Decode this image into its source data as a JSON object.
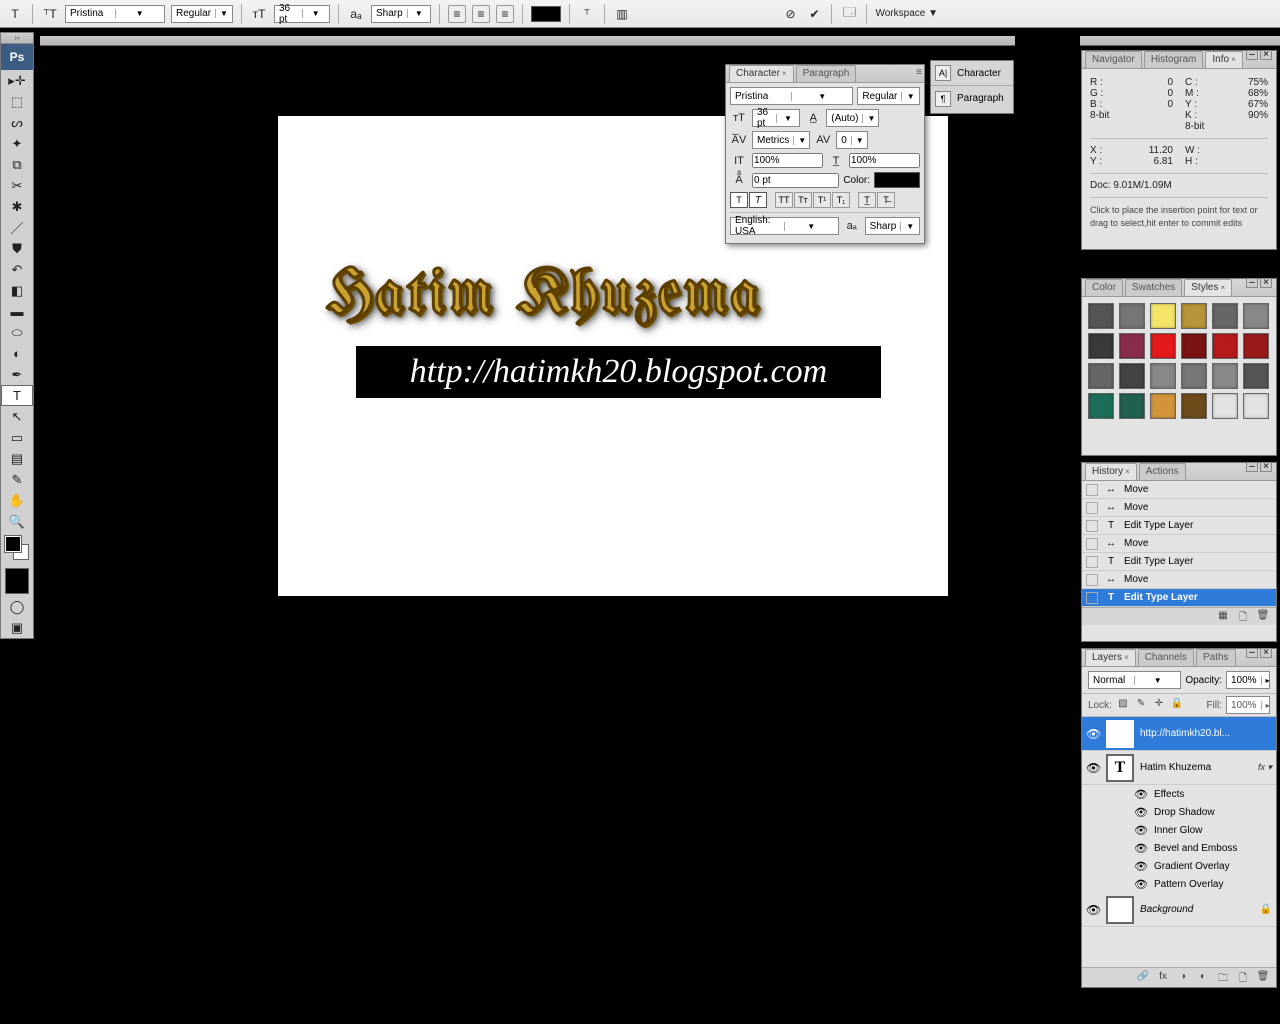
{
  "options": {
    "font": "Pristina",
    "weight": "Regular",
    "size": "36 pt",
    "aa": "Sharp",
    "workspace": "Workspace ▼"
  },
  "canvas": {
    "gold_text": "Hatim Khuzema",
    "url_text": "http://hatimkh20.blogspot.com"
  },
  "char_panel": {
    "tab1": "Character",
    "tab2": "Paragraph",
    "font": "Pristina",
    "weight": "Regular",
    "size": "36 pt",
    "leading": "(Auto)",
    "kerning": "Metrics",
    "tracking": "0",
    "vscale": "100%",
    "hscale": "100%",
    "baseline": "0 pt",
    "color_label": "Color:",
    "lang": "English: USA",
    "aa2": "Sharp"
  },
  "dock": {
    "char": "Character",
    "para": "Paragraph"
  },
  "info": {
    "tabs": [
      "Navigator",
      "Histogram",
      "Info"
    ],
    "r": "R :",
    "rv": "0",
    "g": "G :",
    "gv": "0",
    "b": "B :",
    "bv": "0",
    "c": "C :",
    "cv": "75%",
    "m": "M :",
    "mv": "68%",
    "y": "Y :",
    "yv": "67%",
    "k": "K :",
    "kv": "90%",
    "bit1": "8-bit",
    "bit2": "8-bit",
    "x": "X :",
    "xv": "11.20",
    "yl": "Y :",
    "ylv": "6.81",
    "w": "W :",
    "wv": "",
    "h": "H :",
    "hv": "",
    "doc": "Doc: 9.01M/1.09M",
    "hint": "Click to place the insertion point for text or drag to select,hit enter to commit edits"
  },
  "styles": {
    "tabs": [
      "Color",
      "Swatches",
      "Styles"
    ],
    "colors": [
      "#555",
      "#777",
      "#f5e46a",
      "#b5953a",
      "#666",
      "#888",
      "#3a3a3a",
      "#8a2d4a",
      "#e41a1a",
      "#7a1313",
      "#b71a1a",
      "#9a1a1a",
      "#666",
      "#444",
      "#888",
      "#777",
      "#888",
      "#555",
      "#1c6e5a",
      "#206050",
      "#d2943a",
      "#6d4a1a",
      "#e3e3e3",
      "#e3e3e3"
    ]
  },
  "history": {
    "tabs": [
      "History",
      "Actions"
    ],
    "items": [
      {
        "icon": "↔",
        "label": "Move",
        "sel": false
      },
      {
        "icon": "↔",
        "label": "Move",
        "sel": false
      },
      {
        "icon": "T",
        "label": "Edit Type Layer",
        "sel": false
      },
      {
        "icon": "↔",
        "label": "Move",
        "sel": false
      },
      {
        "icon": "T",
        "label": "Edit Type Layer",
        "sel": false
      },
      {
        "icon": "↔",
        "label": "Move",
        "sel": false
      },
      {
        "icon": "T",
        "label": "Edit Type Layer",
        "sel": true
      }
    ]
  },
  "layers": {
    "tabs": [
      "Layers",
      "Channels",
      "Paths"
    ],
    "mode": "Normal",
    "opacity_label": "Opacity:",
    "opacity": "100%",
    "lock_label": "Lock:",
    "fill_label": "Fill:",
    "fill": "100%",
    "items": [
      {
        "thumb": "T",
        "name": "http://hatimkh20.bl...",
        "sel": true,
        "fx": false,
        "bg": false
      },
      {
        "thumb": "T",
        "name": "Hatim Khuzema",
        "sel": false,
        "fx": true,
        "bg": false
      }
    ],
    "fx_label": "Effects",
    "fx_items": [
      "Drop Shadow",
      "Inner Glow",
      "Bevel and Emboss",
      "Gradient Overlay",
      "Pattern Overlay"
    ],
    "bg": {
      "name": "Background",
      "italic": true
    }
  }
}
